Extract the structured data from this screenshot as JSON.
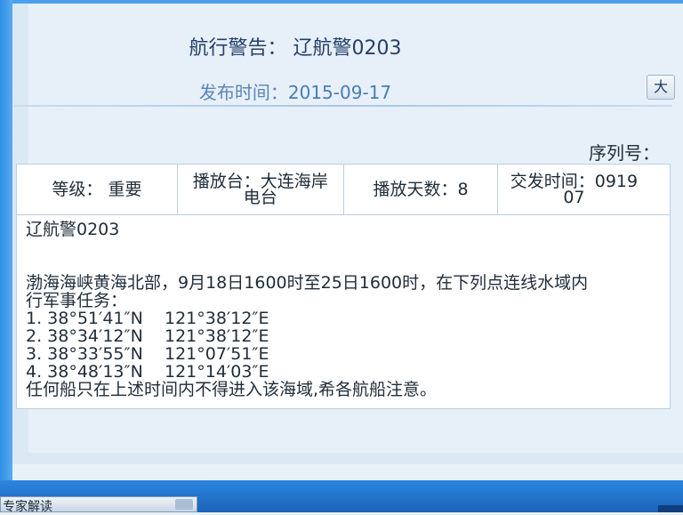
{
  "notice": {
    "title_prefix": "航行警告：",
    "title_code": "辽航警0203",
    "pubtime_label": "发布时间：",
    "pubtime_value": "2015-09-17",
    "font_button": "大",
    "serial_label": "序列号："
  },
  "info_row": {
    "level": "等级：  重要",
    "station": "播放台：大连海岸电台",
    "days": "播放天数：8",
    "issue_time": "交发时间：091907"
  },
  "content": {
    "code": "辽航警0203",
    "body_line1": "渤海海峡黄海北部，9月18日1600时至25日1600时，在下列点连线水域内",
    "body_line2": "行军事任务：",
    "points": [
      "1. 38°51′41″N    121°38′12″E",
      "2. 38°34′12″N    121°38′12″E",
      "3. 38°33′55″N    121°07′51″E",
      "4. 38°48′13″N    121°14′03″E"
    ],
    "closing": "任何船只在上述时间内不得进入该海域,希各航船注意。"
  },
  "taskbar": {
    "scroll_label": "专家解读"
  },
  "colors": {
    "frame_blue": "#2f8fe4",
    "panel_bg": "#e7f0f8",
    "title_color": "#26406a",
    "date_color": "#5b86b8"
  }
}
